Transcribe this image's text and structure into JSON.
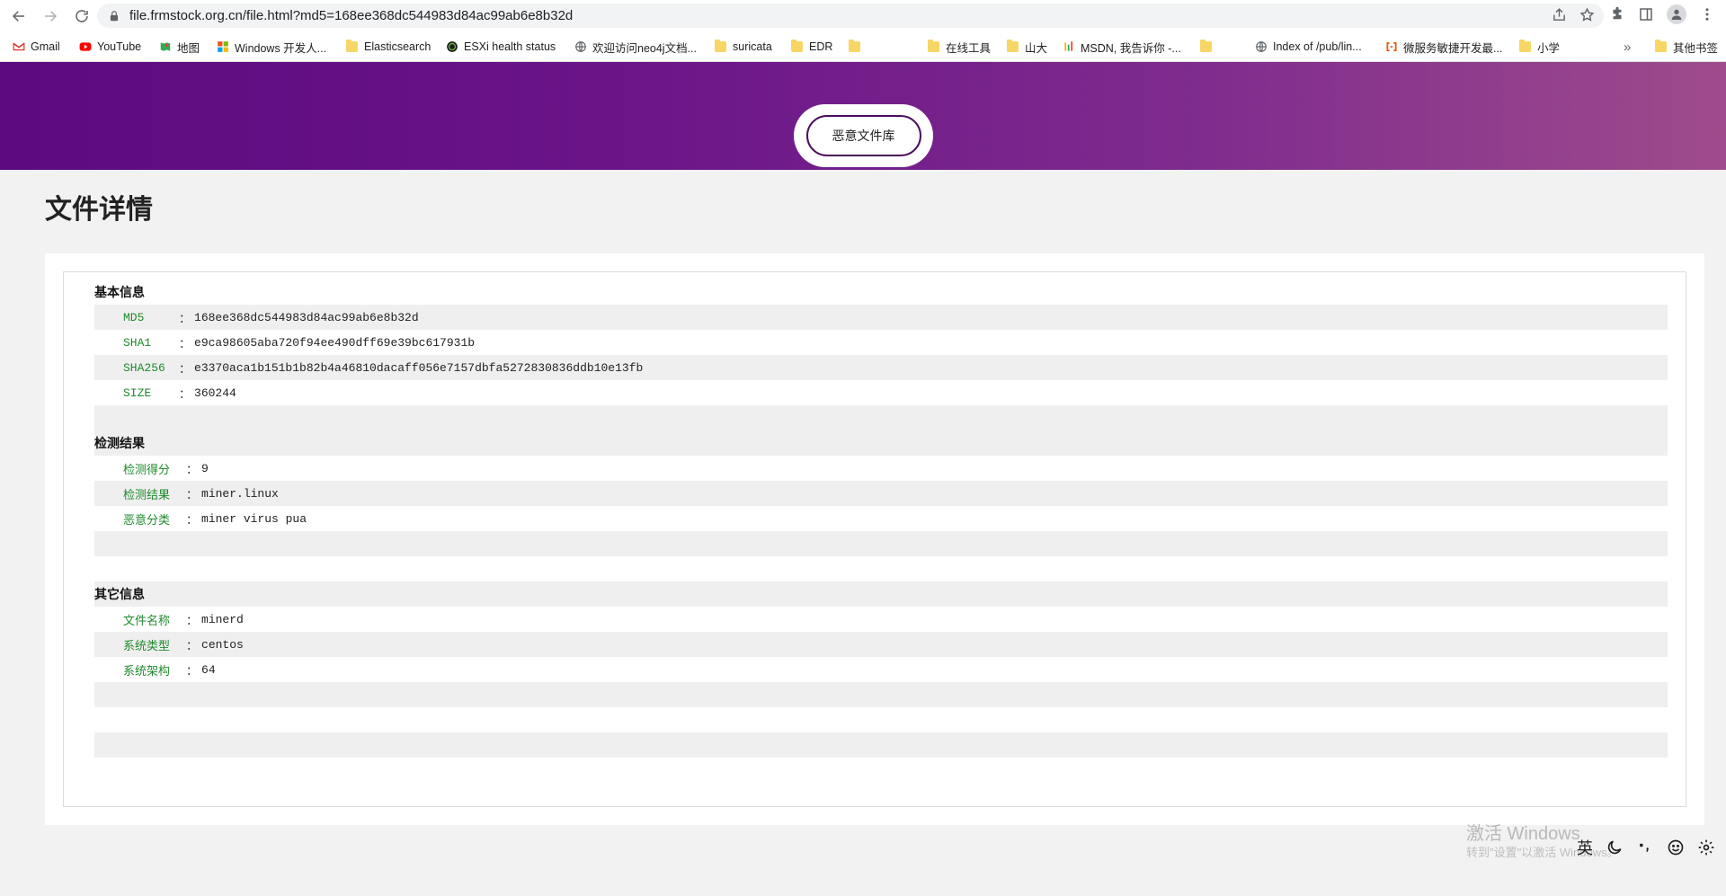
{
  "browser": {
    "url": "file.frmstock.org.cn/file.html?md5=168ee368dc544983d84ac99ab6e8b32d",
    "bookmarks": [
      {
        "label": "Gmail",
        "icon": "gmail-icon"
      },
      {
        "label": "YouTube",
        "icon": "youtube-icon"
      },
      {
        "label": "地图",
        "icon": "maps-icon"
      },
      {
        "label": "Windows 开发人...",
        "icon": "windows-icon"
      },
      {
        "label": "Elasticsearch",
        "icon": "folder-icon"
      },
      {
        "label": "ESXi health status",
        "icon": "esxi-icon"
      },
      {
        "label": "欢迎访问neo4j文档...",
        "icon": "globe-icon"
      },
      {
        "label": "suricata",
        "icon": "folder-icon"
      },
      {
        "label": "EDR",
        "icon": "folder-icon"
      },
      {
        "label": "",
        "icon": "folder-icon"
      },
      {
        "label": "在线工具",
        "icon": "folder-icon"
      },
      {
        "label": "山大",
        "icon": "folder-icon"
      },
      {
        "label": "MSDN, 我告诉你 -...",
        "icon": "msdn-icon"
      },
      {
        "label": "",
        "icon": "folder-icon"
      },
      {
        "label": "Index of /pub/lin...",
        "icon": "globe-icon"
      },
      {
        "label": "微服务敏捷开发最...",
        "icon": "microservice-icon"
      },
      {
        "label": "小学",
        "icon": "folder-icon"
      }
    ],
    "overflow": "»",
    "other_bookmarks": "其他书签"
  },
  "header": {
    "library_button": "恶意文件库"
  },
  "page": {
    "title": "文件详情"
  },
  "sections": {
    "basic": {
      "title": "基本信息",
      "rows": [
        {
          "key": "MD5",
          "value": "168ee368dc544983d84ac99ab6e8b32d"
        },
        {
          "key": "SHA1",
          "value": "e9ca98605aba720f94ee490dff69e39bc617931b"
        },
        {
          "key": "SHA256",
          "value": "e3370aca1b151b1b82b4a46810dacaff056e7157dbfa5272830836ddb10e13fb"
        },
        {
          "key": "SIZE",
          "value": "360244"
        }
      ]
    },
    "detect": {
      "title": "检测结果",
      "rows": [
        {
          "key": "检测得分",
          "value": "9"
        },
        {
          "key": "检测结果",
          "value": "miner.linux"
        },
        {
          "key": "恶意分类",
          "value": "miner virus pua"
        }
      ]
    },
    "other": {
      "title": "其它信息",
      "rows": [
        {
          "key": "文件名称",
          "value": "minerd"
        },
        {
          "key": "系统类型",
          "value": "centos"
        },
        {
          "key": "系统架构",
          "value": "64"
        }
      ]
    }
  },
  "separator": "：",
  "watermark": {
    "line1": "激活 Windows",
    "line2": "转到\"设置\"以激活 Windows。"
  },
  "ime": {
    "lang": "英"
  }
}
